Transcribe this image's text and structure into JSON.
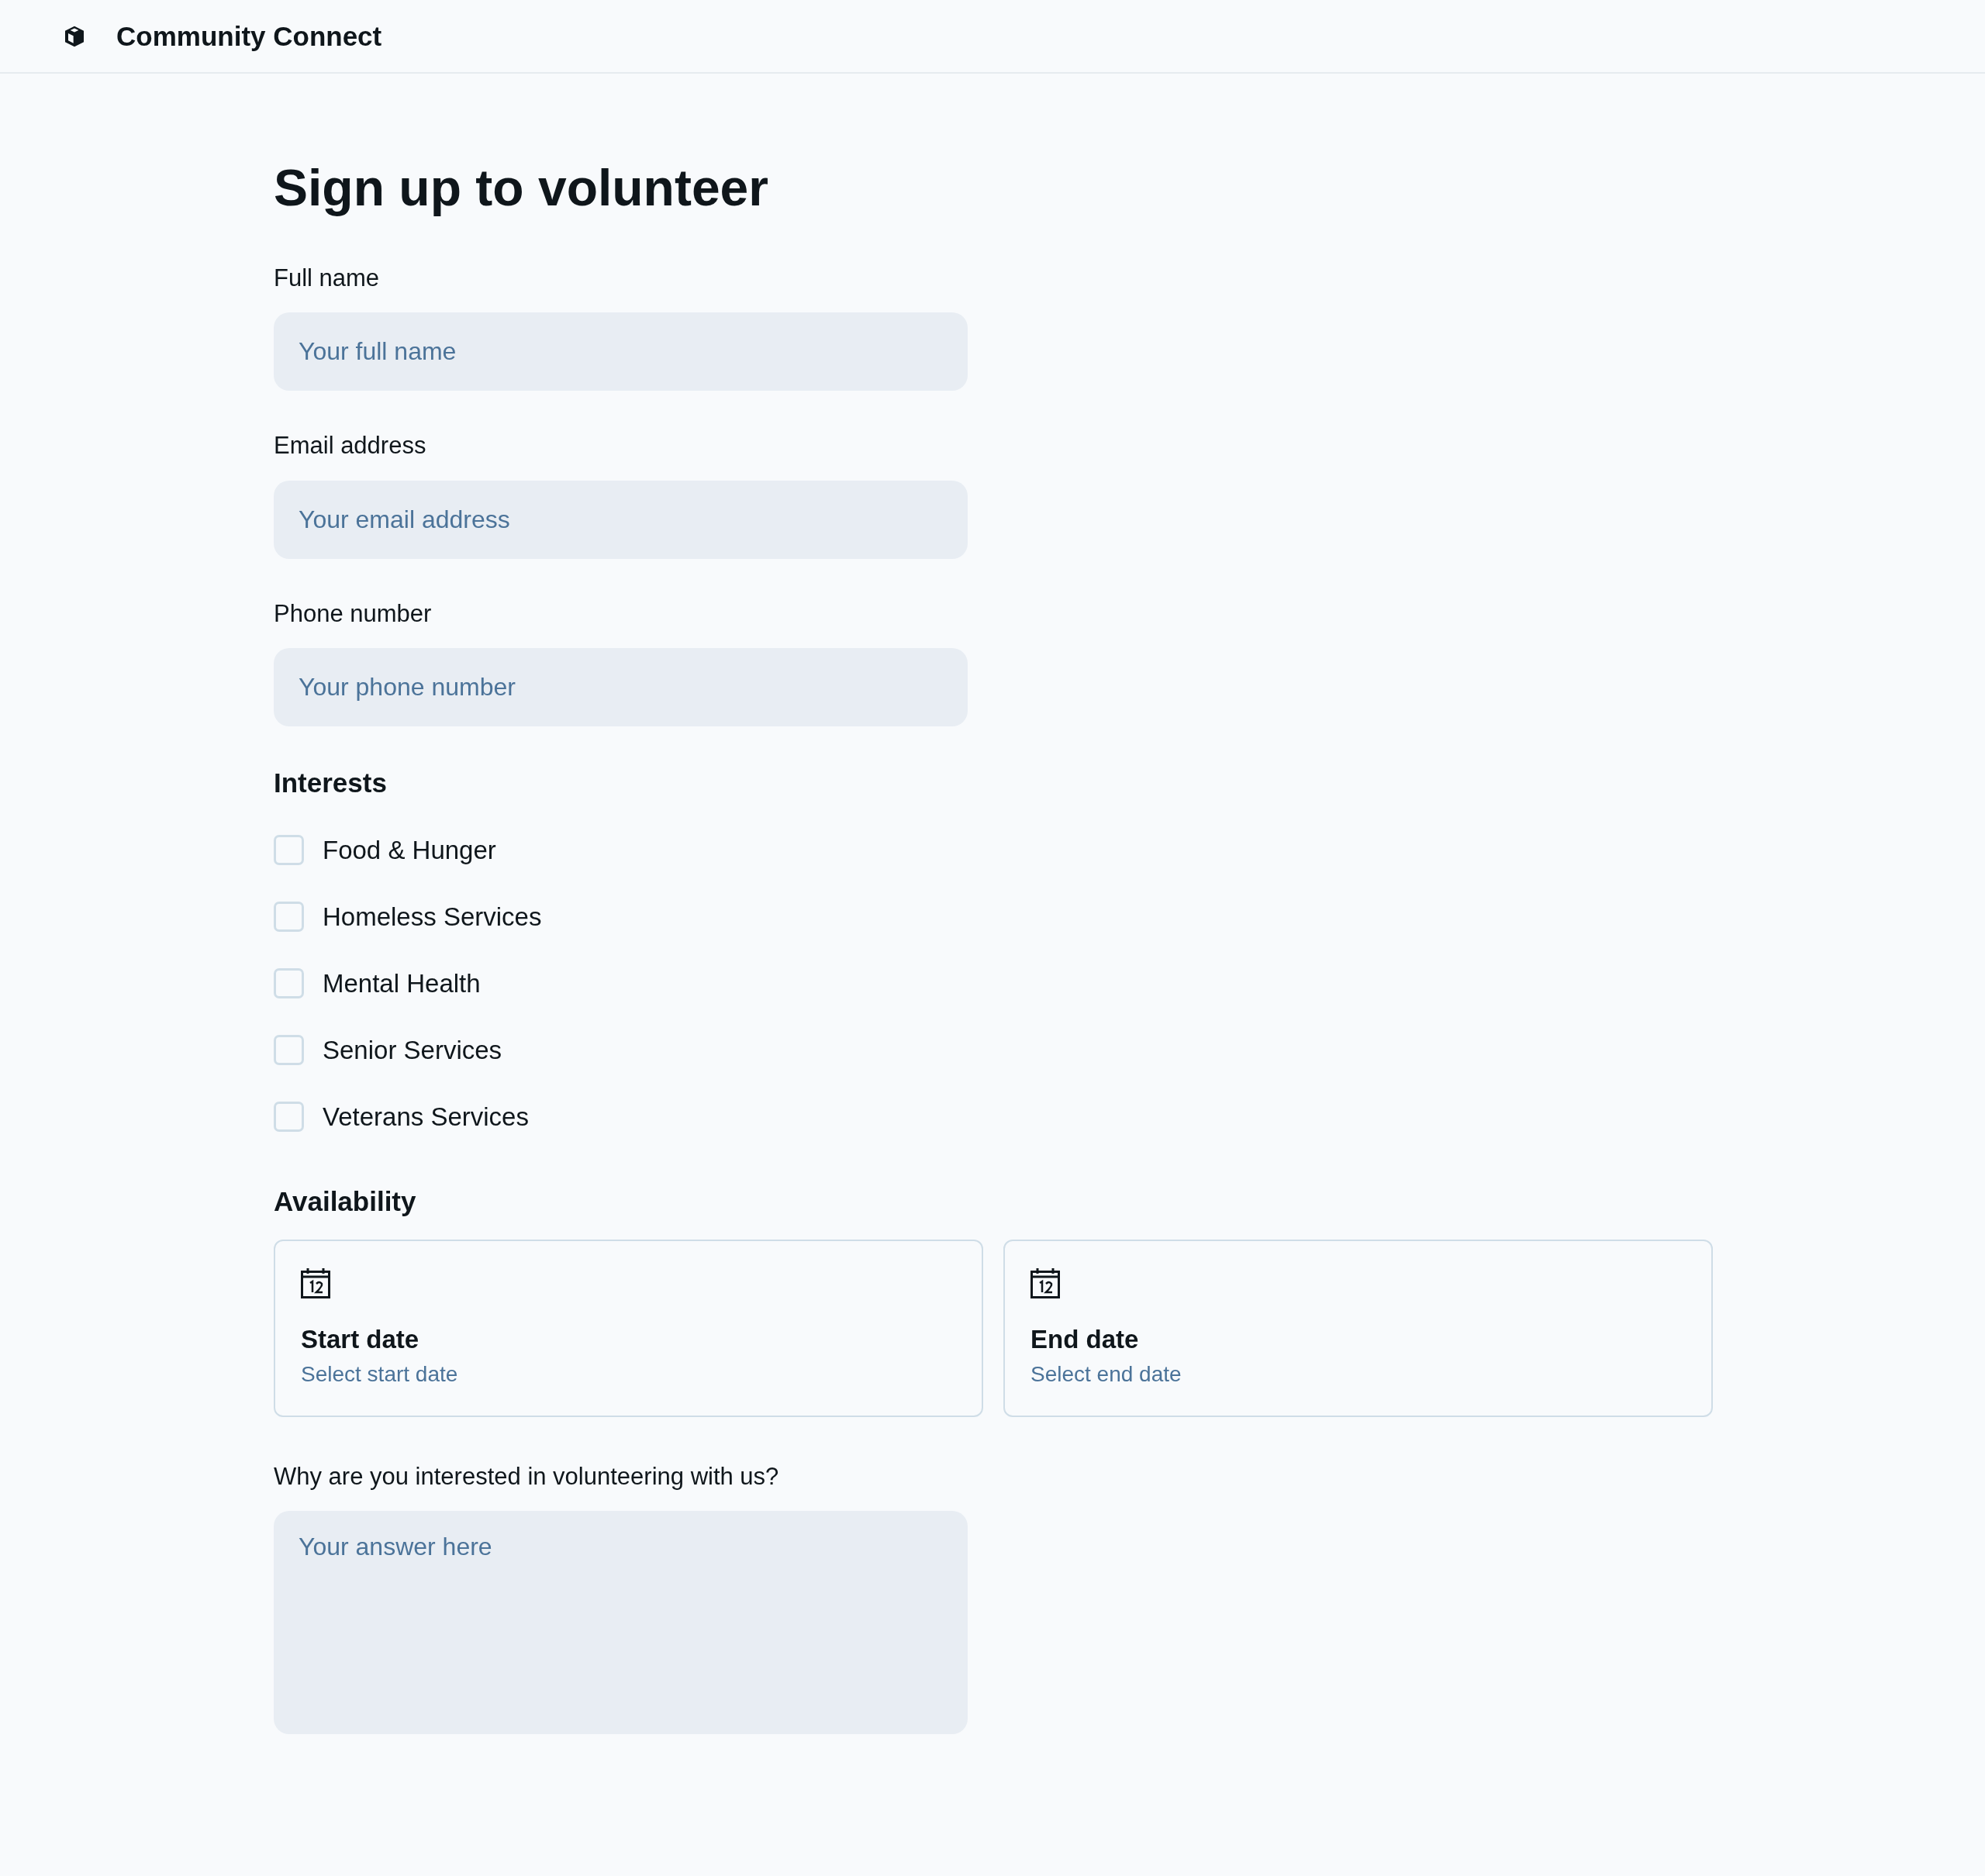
{
  "header": {
    "title": "Community Connect"
  },
  "heading": "Sign up to volunteer",
  "fields": [
    {
      "label": "Full name",
      "placeholder": "Your full name"
    },
    {
      "label": "Email address",
      "placeholder": "Your email address"
    },
    {
      "label": "Phone number",
      "placeholder": "Your phone number"
    }
  ],
  "interests": {
    "title": "Interests",
    "options": [
      {
        "label": "Food & Hunger",
        "checked": false
      },
      {
        "label": "Homeless Services",
        "checked": false
      },
      {
        "label": "Mental Health",
        "checked": false
      },
      {
        "label": "Senior Services",
        "checked": false
      },
      {
        "label": "Veterans Services",
        "checked": false
      }
    ]
  },
  "availability": {
    "title": "Availability",
    "dates": [
      {
        "title": "Start date",
        "hint": "Select start date"
      },
      {
        "title": "End date",
        "hint": "Select end date"
      }
    ]
  },
  "question": {
    "label": "Why are you interested in volunteering with us?",
    "placeholder": "Your answer here"
  }
}
